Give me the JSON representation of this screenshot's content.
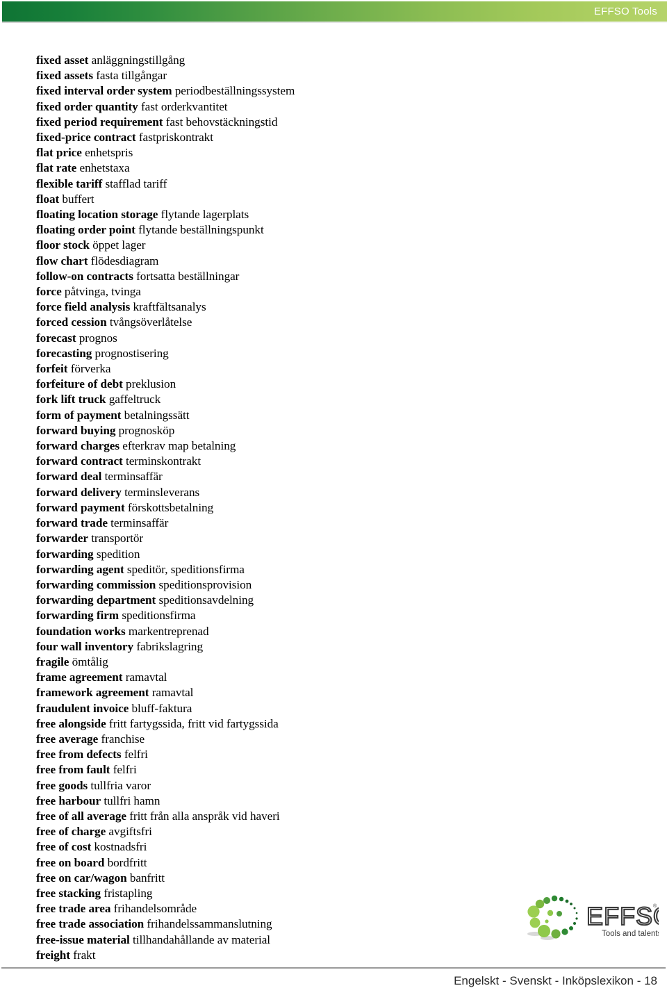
{
  "header": {
    "brand_label": "EFFSO Tools",
    "gradient_start": "#0f7434",
    "gradient_end": "#b5d36a",
    "text_color": "#ffffff"
  },
  "glossary": {
    "entries": [
      {
        "term": "fixed asset",
        "translation": "anläggningstillgång"
      },
      {
        "term": "fixed assets",
        "translation": "fasta tillgångar"
      },
      {
        "term": "fixed interval order system",
        "translation": "periodbeställningssystem"
      },
      {
        "term": "fixed order quantity",
        "translation": "fast orderkvantitet"
      },
      {
        "term": "fixed period requirement",
        "translation": "fast behovstäckningstid"
      },
      {
        "term": "fixed-price contract",
        "translation": "fastpriskontrakt"
      },
      {
        "term": "flat price",
        "translation": "enhetspris"
      },
      {
        "term": "flat rate",
        "translation": "enhetstaxa"
      },
      {
        "term": "flexible tariff",
        "translation": "stafflad tariff"
      },
      {
        "term": "float",
        "translation": "buffert"
      },
      {
        "term": "floating location storage",
        "translation": "flytande lagerplats"
      },
      {
        "term": "floating order point",
        "translation": "flytande beställningspunkt"
      },
      {
        "term": "floor stock",
        "translation": "öppet lager"
      },
      {
        "term": "flow chart",
        "translation": "flödesdiagram"
      },
      {
        "term": "follow-on contracts",
        "translation": "fortsatta beställningar"
      },
      {
        "term": "force",
        "translation": "påtvinga, tvinga"
      },
      {
        "term": "force field analysis",
        "translation": "kraftfältsanalys"
      },
      {
        "term": "forced cession",
        "translation": "tvångsöverlåtelse"
      },
      {
        "term": "forecast",
        "translation": "prognos"
      },
      {
        "term": "forecasting",
        "translation": "prognostisering"
      },
      {
        "term": "forfeit",
        "translation": "förverka"
      },
      {
        "term": "forfeiture of debt",
        "translation": "preklusion"
      },
      {
        "term": "fork lift truck",
        "translation": "gaffeltruck"
      },
      {
        "term": "form of payment",
        "translation": "betalningssätt"
      },
      {
        "term": "forward buying",
        "translation": "prognosköp"
      },
      {
        "term": "forward charges",
        "translation": "efterkrav map betalning"
      },
      {
        "term": "forward contract",
        "translation": "terminskontrakt"
      },
      {
        "term": "forward deal",
        "translation": "terminsaffär"
      },
      {
        "term": "forward delivery",
        "translation": "terminsleverans"
      },
      {
        "term": "forward payment",
        "translation": "förskottsbetalning"
      },
      {
        "term": "forward trade",
        "translation": "terminsaffär"
      },
      {
        "term": "forwarder",
        "translation": "transportör"
      },
      {
        "term": "forwarding",
        "translation": "spedition"
      },
      {
        "term": "forwarding agent",
        "translation": "speditör, speditionsfirma"
      },
      {
        "term": "forwarding commission",
        "translation": "speditionsprovision"
      },
      {
        "term": "forwarding department",
        "translation": "speditionsavdelning"
      },
      {
        "term": "forwarding firm",
        "translation": "speditionsfirma"
      },
      {
        "term": "foundation works",
        "translation": "markentreprenad"
      },
      {
        "term": "four wall inventory",
        "translation": "fabrikslagring"
      },
      {
        "term": "fragile",
        "translation": "ömtålig"
      },
      {
        "term": "frame agreement",
        "translation": "ramavtal"
      },
      {
        "term": "framework agreement",
        "translation": "ramavtal"
      },
      {
        "term": "fraudulent invoice",
        "translation": "bluff-faktura"
      },
      {
        "term": "free alongside",
        "translation": "fritt fartygssida, fritt vid fartygssida"
      },
      {
        "term": "free average",
        "translation": "franchise"
      },
      {
        "term": "free from defects",
        "translation": "felfri"
      },
      {
        "term": "free from fault",
        "translation": "felfri"
      },
      {
        "term": "free goods",
        "translation": "tullfria varor"
      },
      {
        "term": "free harbour",
        "translation": "tullfri hamn"
      },
      {
        "term": "free of all average",
        "translation": "fritt från alla anspråk vid haveri"
      },
      {
        "term": "free of charge",
        "translation": "avgiftsfri"
      },
      {
        "term": "free of cost",
        "translation": "kostnadsfri"
      },
      {
        "term": "free on board",
        "translation": "bordfritt"
      },
      {
        "term": "free on car/wagon",
        "translation": "banfritt"
      },
      {
        "term": "free stacking",
        "translation": "fristapling"
      },
      {
        "term": "free trade area",
        "translation": "frihandelsområde"
      },
      {
        "term": "free trade association",
        "translation": "frihandelssammanslutning"
      },
      {
        "term": "free-issue material",
        "translation": "tillhandahållande av material"
      },
      {
        "term": "freight",
        "translation": "frakt"
      }
    ]
  },
  "logo": {
    "wordmark": "EFFSO",
    "registered_mark": "®",
    "tagline": "Tools and talents.",
    "wordmark_color": "#3a3a3a",
    "dot_colors": [
      "#7cb342",
      "#96c24f",
      "#a5cc56",
      "#5e9e3e",
      "#2e7d32",
      "#1b6b2a",
      "#8bc34a"
    ]
  },
  "footer": {
    "text": "Engelskt - Svenskt - Inköpslexikon - 18",
    "rule_color": "#9a9a9a"
  }
}
